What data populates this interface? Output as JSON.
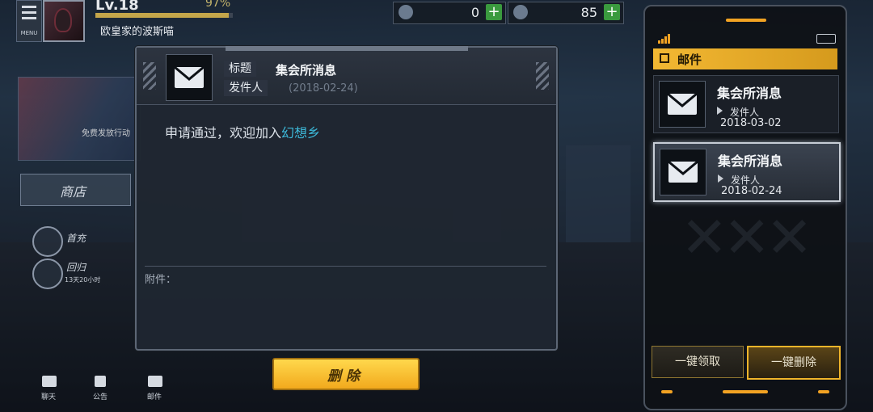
{
  "player": {
    "menu_label": "MENU",
    "level": "Lv.18",
    "exp_percent": "97%",
    "exp_fraction": 0.97,
    "name": "欧皇家的波斯喵"
  },
  "resources": [
    {
      "icon": "gem-icon",
      "value": "0"
    },
    {
      "icon": "cloud-token-icon",
      "value": "85"
    }
  ],
  "side": {
    "banner_text": "免费发放行动",
    "shop_tab": "商店",
    "first_recharge": "首充",
    "return": "回归",
    "return_timer": "13天20小时",
    "bottom": [
      {
        "icon": "chat-icon",
        "label": "聊天"
      },
      {
        "icon": "announcement-icon",
        "label": "公告"
      },
      {
        "icon": "mail-icon",
        "label": "邮件"
      }
    ]
  },
  "dialog": {
    "title_label": "标题",
    "title": "集会所消息",
    "sender_label": "发件人",
    "date": "(2018-02-24)",
    "body_prefix": "申请通过，欢迎加入",
    "body_highlight": "幻想乡",
    "attachment_label": "附件：",
    "delete_label": "删除"
  },
  "mail_panel": {
    "header": "邮件",
    "items": [
      {
        "title": "集会所消息",
        "sender": "发件人",
        "date": "2018-03-02",
        "selected": false
      },
      {
        "title": "集会所消息",
        "sender": "发件人",
        "date": "2018-02-24",
        "selected": true
      }
    ],
    "claim_all": "一键领取",
    "delete_all": "一键删除"
  },
  "colors": {
    "accent": "#f2a323",
    "highlight_text": "#3db9d9",
    "plus_green": "#3a9a3e"
  }
}
